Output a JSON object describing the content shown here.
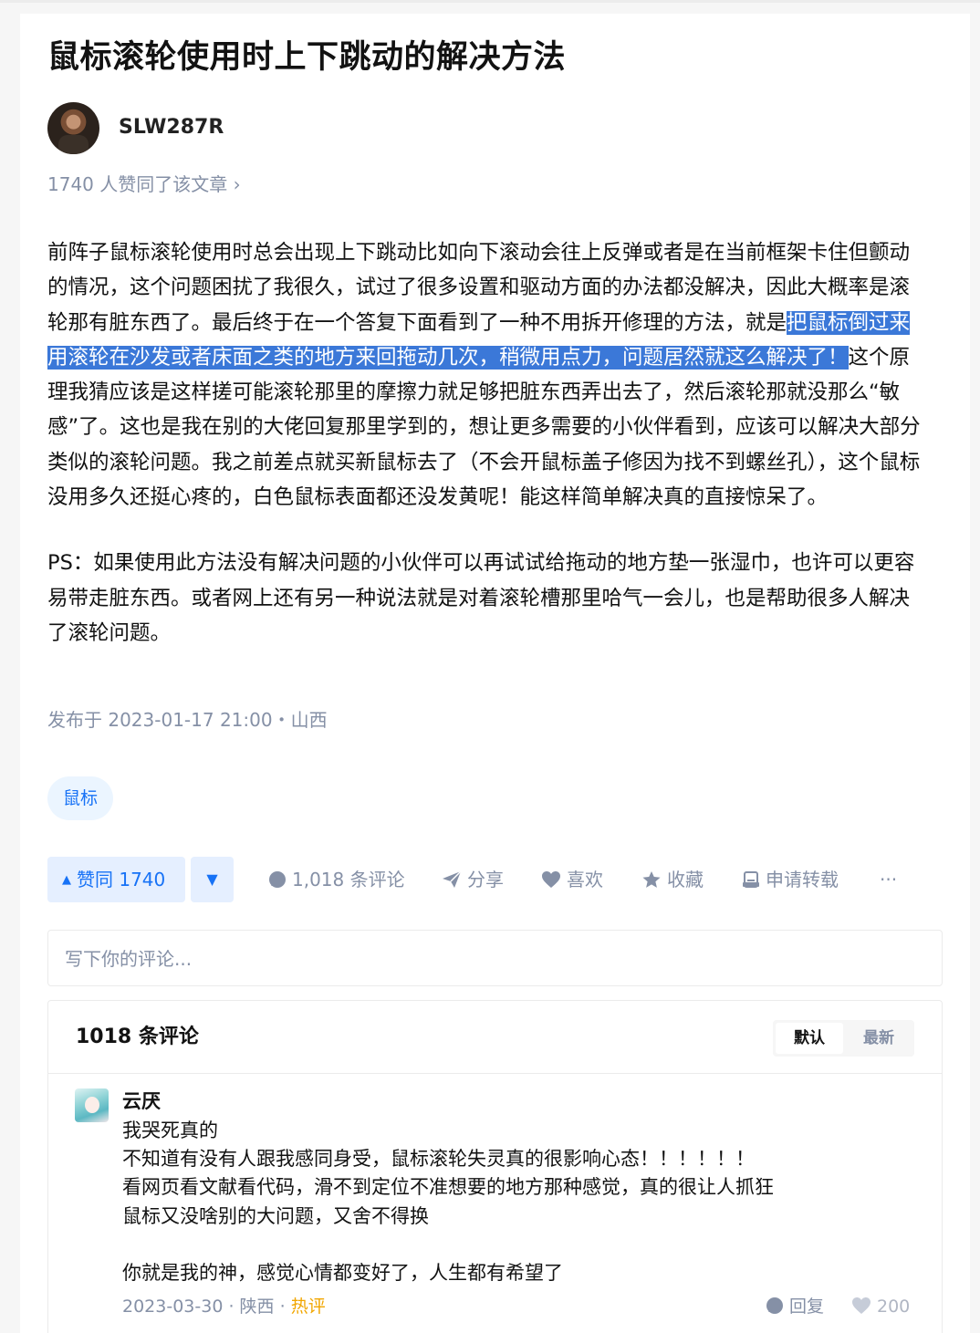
{
  "article": {
    "title": "鼠标滚轮使用时上下跳动的解决方法",
    "author": "SLW287R",
    "likes_line": "1740 人赞同了该文章 ›",
    "paragraph1_a": "前阵子鼠标滚轮使用时总会出现上下跳动比如向下滚动会往上反弹或者是在当前框架卡住但颤动的情况，这个问题困扰了我很久，试过了很多设置和驱动方面的办法都没解决，因此大概率是滚轮那有脏东西了。最后终于在一个答复下面看到了一种不用拆开修理的方法，就是",
    "paragraph1_highlight": "把鼠标倒过来用滚轮在沙发或者床面之类的地方来回拖动几次，稍微用点力，问题居然就这么解决了！",
    "paragraph1_b": "这个原理我猜应该是这样搓可能滚轮那里的摩擦力就足够把脏东西弄出去了，然后滚轮那就没那么“敏感”了。这也是我在别的大佬回复那里学到的，想让更多需要的小伙伴看到，应该可以解决大部分类似的滚轮问题。我之前差点就买新鼠标去了（不会开鼠标盖子修因为找不到螺丝孔），这个鼠标没用多久还挺心疼的，白色鼠标表面都还没发黄呢！能这样简单解决真的直接惊呆了。",
    "paragraph2": "PS：如果使用此方法没有解决问题的小伙伴可以再试试给拖动的地方垫一张湿巾，也许可以更容易带走脏东西。或者网上还有另一种说法就是对着滚轮槽那里哈气一会儿，也是帮助很多人解决了滚轮问题。",
    "publish": "发布于 2023-01-17 21:00・山西",
    "tag": "鼠标"
  },
  "actions": {
    "vote_up": "赞同 1740",
    "vote_down": "▼",
    "comments": "1,018 条评论",
    "share": "分享",
    "like": "喜欢",
    "collect": "收藏",
    "repost": "申请转载",
    "more": "···"
  },
  "comment_input": {
    "placeholder": "写下你的评论..."
  },
  "comments": {
    "count_label": "1018 条评论",
    "sort_default": "默认",
    "sort_latest": "最新",
    "items": [
      {
        "name": "云厌",
        "lines": [
          "我哭死真的",
          "不知道有没有人跟我感同身受，鼠标滚轮失灵真的很影响心态！！！！！！",
          "看网页看文献看代码，滑不到定位不准想要的地方那种感觉，真的很让人抓狂",
          "鼠标又没啥别的大问题，又舍不得换",
          "",
          "你就是我的神，感觉心情都变好了，人生都有希望了"
        ],
        "date": "2023-03-30",
        "location": "陕西",
        "hot": "热评",
        "reply": "回复",
        "likes": "200"
      }
    ]
  },
  "colors": {
    "accent": "#1772f6",
    "meta": "#8590a6",
    "highlight": "#3b78d8",
    "hot": "#f1a600"
  }
}
